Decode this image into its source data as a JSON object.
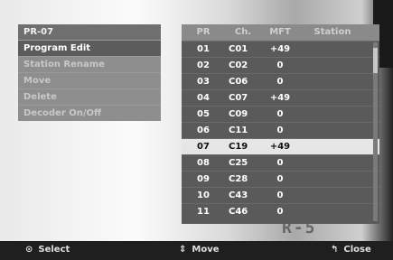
{
  "menu": {
    "title": "PR-07",
    "items": [
      {
        "label": "Program Edit",
        "active": true
      },
      {
        "label": "Station Rename",
        "active": false
      },
      {
        "label": "Move",
        "active": false
      },
      {
        "label": "Delete",
        "active": false
      },
      {
        "label": "Decoder On/Off",
        "active": false
      }
    ]
  },
  "table": {
    "headers": [
      "PR",
      "Ch.",
      "MFT",
      "Station"
    ],
    "rows": [
      {
        "pr": "01",
        "ch": "C01",
        "mft": "+49",
        "station": ""
      },
      {
        "pr": "02",
        "ch": "C02",
        "mft": "0",
        "station": ""
      },
      {
        "pr": "03",
        "ch": "C06",
        "mft": "0",
        "station": ""
      },
      {
        "pr": "04",
        "ch": "C07",
        "mft": "+49",
        "station": ""
      },
      {
        "pr": "05",
        "ch": "C09",
        "mft": "0",
        "station": ""
      },
      {
        "pr": "06",
        "ch": "C11",
        "mft": "0",
        "station": ""
      },
      {
        "pr": "07",
        "ch": "C19",
        "mft": "+49",
        "station": "",
        "selected": true
      },
      {
        "pr": "08",
        "ch": "C25",
        "mft": "0",
        "station": ""
      },
      {
        "pr": "09",
        "ch": "C28",
        "mft": "0",
        "station": ""
      },
      {
        "pr": "10",
        "ch": "C43",
        "mft": "0",
        "station": ""
      },
      {
        "pr": "11",
        "ch": "C46",
        "mft": "0",
        "station": ""
      }
    ]
  },
  "footer": {
    "select": {
      "icon": "select-icon",
      "label": "Select",
      "glyph": "⊙"
    },
    "move": {
      "icon": "move-updown-icon",
      "label": "Move",
      "glyph": "⇕"
    },
    "close": {
      "icon": "return-icon",
      "label": "Close",
      "glyph": "↰"
    }
  },
  "background": {
    "logo_text": "R-5"
  }
}
